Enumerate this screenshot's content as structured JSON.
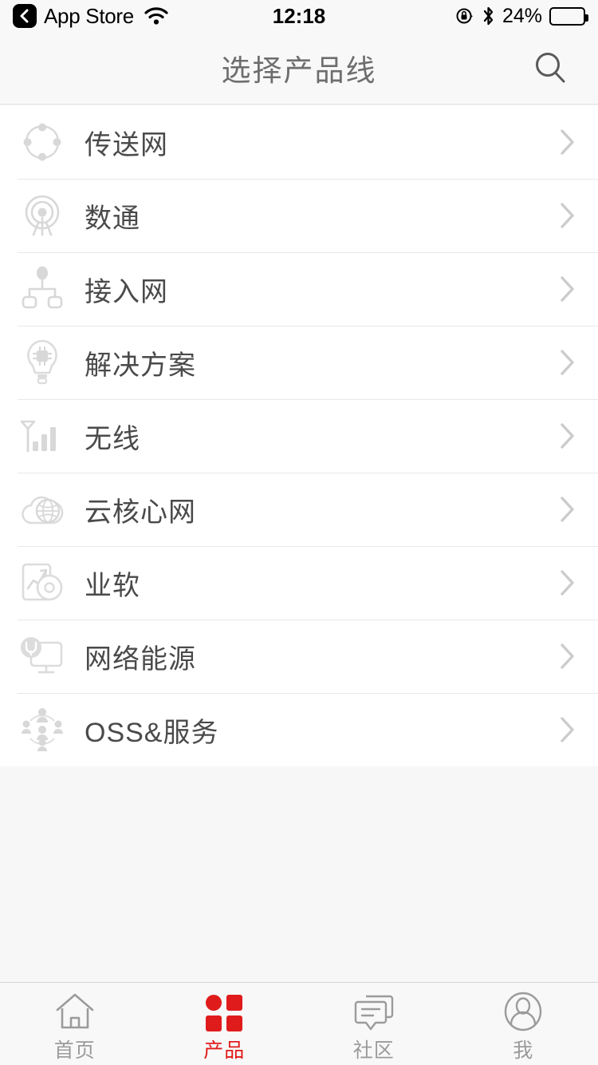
{
  "status_bar": {
    "back_icon": "back-chevron-icon",
    "app_name": "App Store",
    "wifi_icon": "wifi-icon",
    "time": "12:18",
    "rotation_lock_icon": "rotation-lock-icon",
    "bluetooth_icon": "bluetooth-icon",
    "battery_percent": "24%",
    "battery_level": 24
  },
  "navbar": {
    "title": "选择产品线",
    "search_icon": "search-icon"
  },
  "list": {
    "items": [
      {
        "label": "传送网",
        "icon": "transport-network-icon",
        "chevron": "chevron-right-icon"
      },
      {
        "label": "数通",
        "icon": "data-communication-icon",
        "chevron": "chevron-right-icon"
      },
      {
        "label": "接入网",
        "icon": "access-network-icon",
        "chevron": "chevron-right-icon"
      },
      {
        "label": "解决方案",
        "icon": "solution-lightbulb-icon",
        "chevron": "chevron-right-icon"
      },
      {
        "label": "无线",
        "icon": "wireless-signal-icon",
        "chevron": "chevron-right-icon"
      },
      {
        "label": "云核心网",
        "icon": "cloud-core-network-icon",
        "chevron": "chevron-right-icon"
      },
      {
        "label": "业软",
        "icon": "business-software-icon",
        "chevron": "chevron-right-icon"
      },
      {
        "label": "网络能源",
        "icon": "network-energy-icon",
        "chevron": "chevron-right-icon"
      },
      {
        "label": "OSS&服务",
        "icon": "oss-service-icon",
        "chevron": "chevron-right-icon"
      }
    ]
  },
  "tabbar": {
    "active_index": 1,
    "tabs": [
      {
        "label": "首页",
        "icon": "home-icon"
      },
      {
        "label": "产品",
        "icon": "products-grid-icon"
      },
      {
        "label": "社区",
        "icon": "community-chat-icon"
      },
      {
        "label": "我",
        "icon": "profile-person-icon"
      }
    ]
  },
  "colors": {
    "accent": "#e01b1b",
    "label_text": "#4a4a4a",
    "muted_text": "#9b9b9b",
    "icon_gray": "#d8d8d8",
    "chevron": "#cccccc",
    "page_bg": "#f7f7f7",
    "bar_bg": "#f8f8f8"
  }
}
